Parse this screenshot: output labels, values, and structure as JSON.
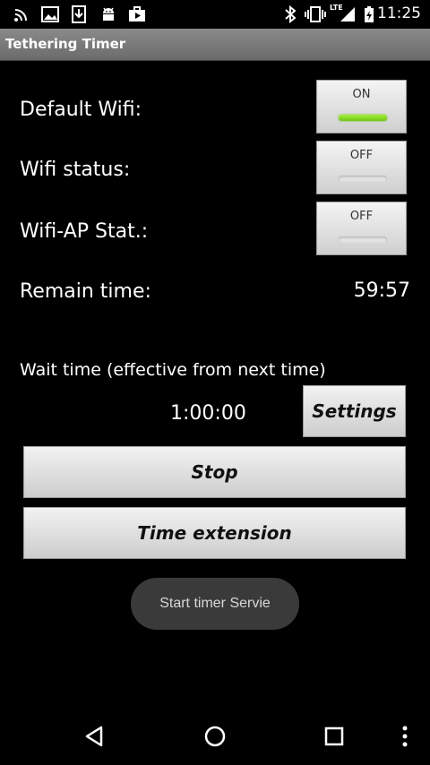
{
  "status_bar": {
    "time": "11:25",
    "lte": "LTE",
    "left_icons": [
      "wifi-hotspot-icon",
      "image-icon",
      "download-icon",
      "android-icon",
      "briefcase-play-icon"
    ],
    "right_icons": [
      "bluetooth-icon",
      "vibrate-icon",
      "signal-icon",
      "battery-charging-icon"
    ]
  },
  "app": {
    "title": "Tethering Timer"
  },
  "rows": {
    "default_wifi": {
      "label": "Default Wifi:",
      "toggle": "ON"
    },
    "wifi_status": {
      "label": "Wifi status:",
      "toggle": "OFF"
    },
    "wifi_ap": {
      "label": "Wifi-AP Stat.:",
      "toggle": "OFF"
    },
    "remain": {
      "label": "Remain time:",
      "value": "59:57"
    }
  },
  "wait": {
    "label": "Wait time (effective from next time)",
    "value": "1:00:00",
    "settings_button": "Settings"
  },
  "buttons": {
    "stop": "Stop",
    "extension": "Time extension"
  },
  "toast": "Start timer Servie",
  "colors": {
    "toggle_on": "#7ed321",
    "background": "#000000",
    "titlebar": "#7a7a7a"
  }
}
